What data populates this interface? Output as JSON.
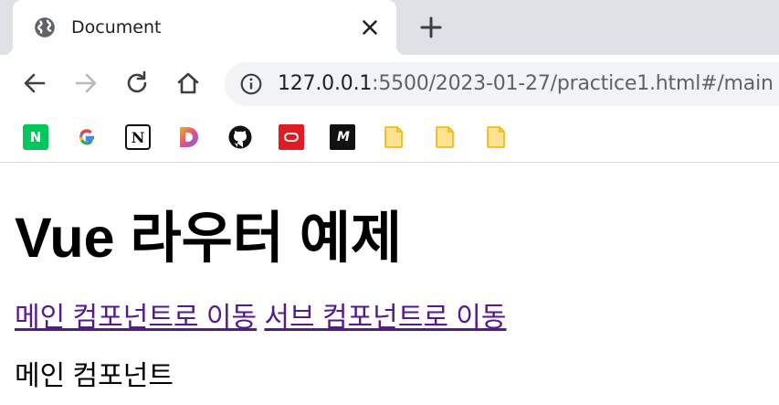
{
  "browser": {
    "tab": {
      "title": "Document",
      "favicon_icon": "globe-icon",
      "close_icon": "close-icon"
    },
    "new_tab_icon": "plus-icon",
    "toolbar": {
      "back_icon": "arrow-left-icon",
      "forward_icon": "arrow-right-icon",
      "reload_icon": "reload-icon",
      "home_icon": "home-icon"
    },
    "address_bar": {
      "info_icon": "info-icon",
      "host": "127.0.0.1",
      "path": ":5500/2023-01-27/practice1.html#/main"
    },
    "bookmarks": [
      {
        "icon": "naver-icon",
        "glyph": "N"
      },
      {
        "icon": "google-icon"
      },
      {
        "icon": "notion-icon",
        "glyph": "N"
      },
      {
        "icon": "dribbble-d-icon"
      },
      {
        "icon": "github-icon"
      },
      {
        "icon": "oracle-icon"
      },
      {
        "icon": "medium-icon",
        "glyph": "M"
      },
      {
        "icon": "file-icon"
      },
      {
        "icon": "file-icon"
      },
      {
        "icon": "file-icon"
      }
    ],
    "colors": {
      "tab_strip": "#dee1e6",
      "omnibox": "#f1f3f4",
      "visited_link": "#551a8b"
    }
  },
  "page": {
    "title": "Vue 라우터 예제",
    "links": {
      "main": "메인 컴포넌트로 이동",
      "sub": "서브 컴포넌트로 이동"
    },
    "router_view_text": "메인 컴포넌트"
  }
}
